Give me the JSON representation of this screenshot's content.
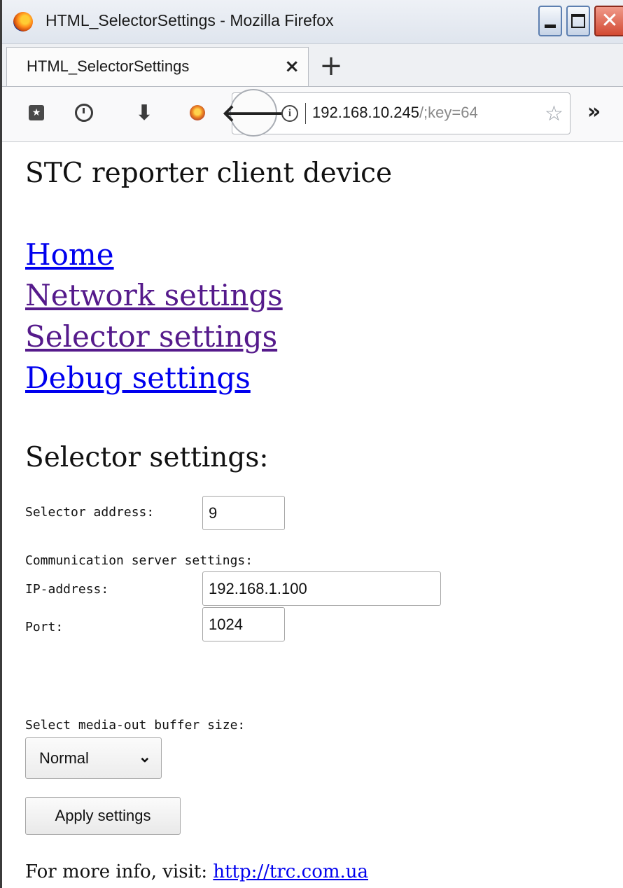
{
  "window": {
    "title": "HTML_SelectorSettings - Mozilla Firefox",
    "minimize_glyph": "",
    "maximize_glyph": "",
    "close_glyph": "✕"
  },
  "tabs": [
    {
      "label": "HTML_SelectorSettings",
      "close_glyph": "×"
    }
  ],
  "new_tab_glyph": "+",
  "toolbar": {
    "icons": [
      "bookmarks-icon",
      "history-icon",
      "downloads-icon",
      "persona-icon"
    ],
    "download_glyph": "⬇",
    "back_glyph": "🡐",
    "info_glyph": "i",
    "url_host": "192.168.10.245",
    "url_path": "/;key=64",
    "star_glyph": "☆",
    "overflow_glyph": "»"
  },
  "page": {
    "site_title": "STC reporter client device",
    "nav": [
      {
        "label": "Home",
        "visited": false
      },
      {
        "label": "Network settings",
        "visited": true
      },
      {
        "label": "Selector settings",
        "visited": true
      },
      {
        "label": "Debug settings",
        "visited": false
      }
    ],
    "section_title": "Selector settings:",
    "selector_address_label": "Selector address:",
    "selector_address_value": "9",
    "comm_server_label": "Communication server settings:",
    "ip_label": "IP-address:",
    "ip_value": "192.168.1.100",
    "port_label": "Port:",
    "port_value": "1024",
    "buffer_label": "Select media-out buffer size:",
    "buffer_selected": "Normal",
    "apply_label": "Apply settings",
    "footer_prefix": "For more info, visit: ",
    "footer_link": "http://trc.com.ua"
  },
  "colors": {
    "link_unvisited": "#0000ee",
    "link_visited": "#551a8b",
    "close_button": "#d24a33"
  }
}
